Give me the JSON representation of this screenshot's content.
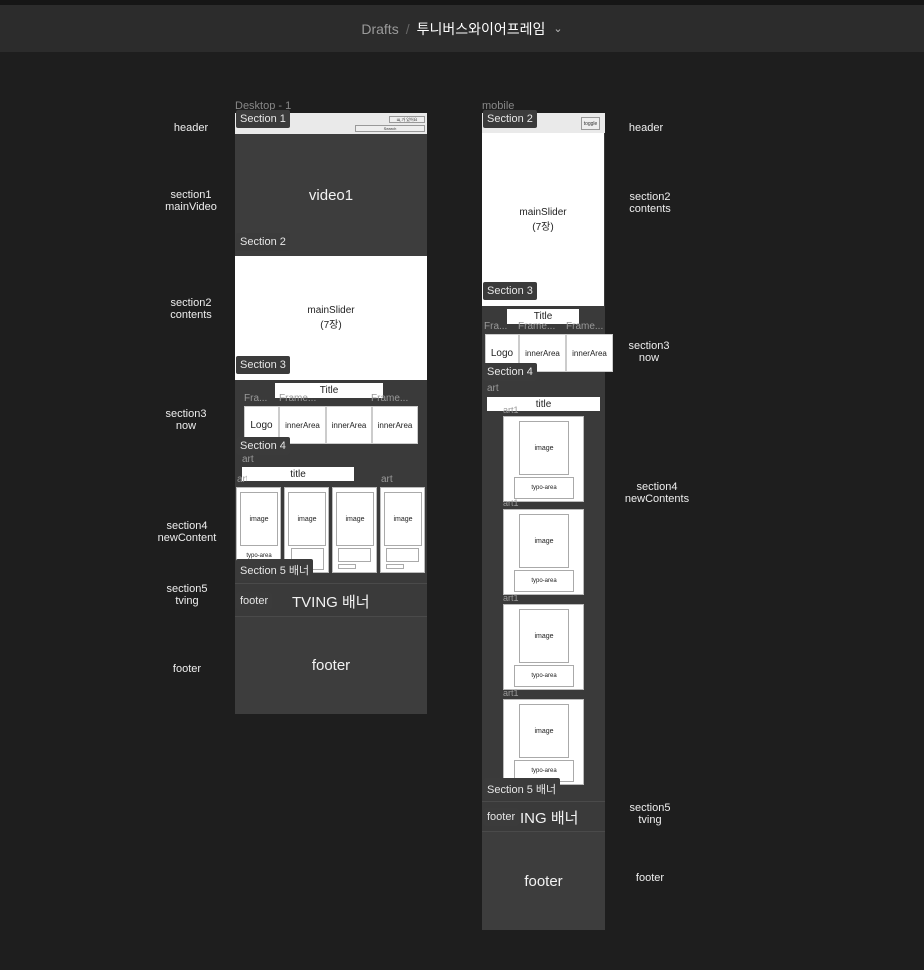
{
  "breadcrumb": {
    "parent": "Drafts",
    "separator": "/",
    "current": "투니버스와이어프레임",
    "chevron": "⌄"
  },
  "desktop": {
    "frame_title": "Desktop - 1",
    "header_btn1": "Щ 가 있어요",
    "header_btn2": "Search",
    "video": "video1",
    "slider": "mainSlider",
    "slider_sub": "(7장)",
    "now_title": "Title",
    "now_frame_labels": [
      "Fra...",
      "Frame...",
      "Frame..."
    ],
    "logo": "Logo",
    "inner": [
      "innerArea",
      "innerArea",
      "innerArea"
    ],
    "art_label": "art",
    "art_title": "title",
    "card_labels": [
      "art",
      "art",
      "art",
      "art"
    ],
    "image": "image",
    "typo": "typo-area",
    "tving": "TVING 배너",
    "footer": "footer",
    "sections": [
      "Section 1",
      "Section 2",
      "Section 3",
      "Section 4",
      "Section 5 배너",
      "footer"
    ]
  },
  "mobile": {
    "frame_title": "mobile",
    "toggle": "toggle",
    "slider": "mainSlider",
    "slider_sub": "(7장)",
    "now_title": "Title",
    "now_frame_labels": [
      "Fra...",
      "Frame...",
      "Frame..."
    ],
    "logo": "Logo",
    "inner": [
      "innerArea",
      "innerArea"
    ],
    "art_label": "art",
    "art_title": "title",
    "card_label": "art1",
    "image": "image",
    "typo": "typo-area",
    "tving": "TVING 배너",
    "tving_visible": "ING 배너",
    "footer": "footer",
    "sections": [
      "Section 2",
      "Section 3",
      "Section 4",
      "Section 5 배너",
      "footer"
    ]
  },
  "left_notes": [
    "header",
    "section1\nmainVideo",
    "section2\ncontents",
    "section3\nnow",
    "section4\nnewContent",
    "section5\ntving",
    "footer"
  ],
  "right_notes": [
    "header",
    "section2\ncontents",
    "section3\nnow",
    "section4\nnewContents",
    "section5\ntving",
    "footer"
  ]
}
